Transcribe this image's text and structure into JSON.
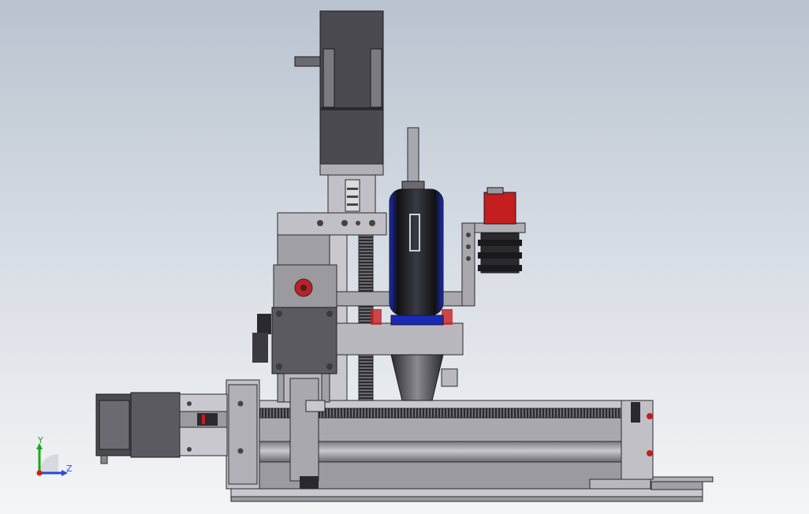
{
  "viewport": {
    "background_top": "#b9c3cf",
    "background_bottom": "#f4f5f7"
  },
  "colors": {
    "metal_light": "#d0d0d6",
    "metal_mid": "#9a9aa0",
    "metal_dark": "#5a5a60",
    "motor_body": "#4a4a50",
    "spindle_blue": "#1a2ab8",
    "spindle_dark": "#2a2a30",
    "accent_red": "#c41e1e",
    "axis_y": "#1aa81a",
    "axis_z": "#2a4ad8",
    "axis_x": "#d81a1a"
  },
  "triad": {
    "y_label": "Y",
    "z_label": "Z",
    "icon": "coordinate-triad-icon"
  }
}
